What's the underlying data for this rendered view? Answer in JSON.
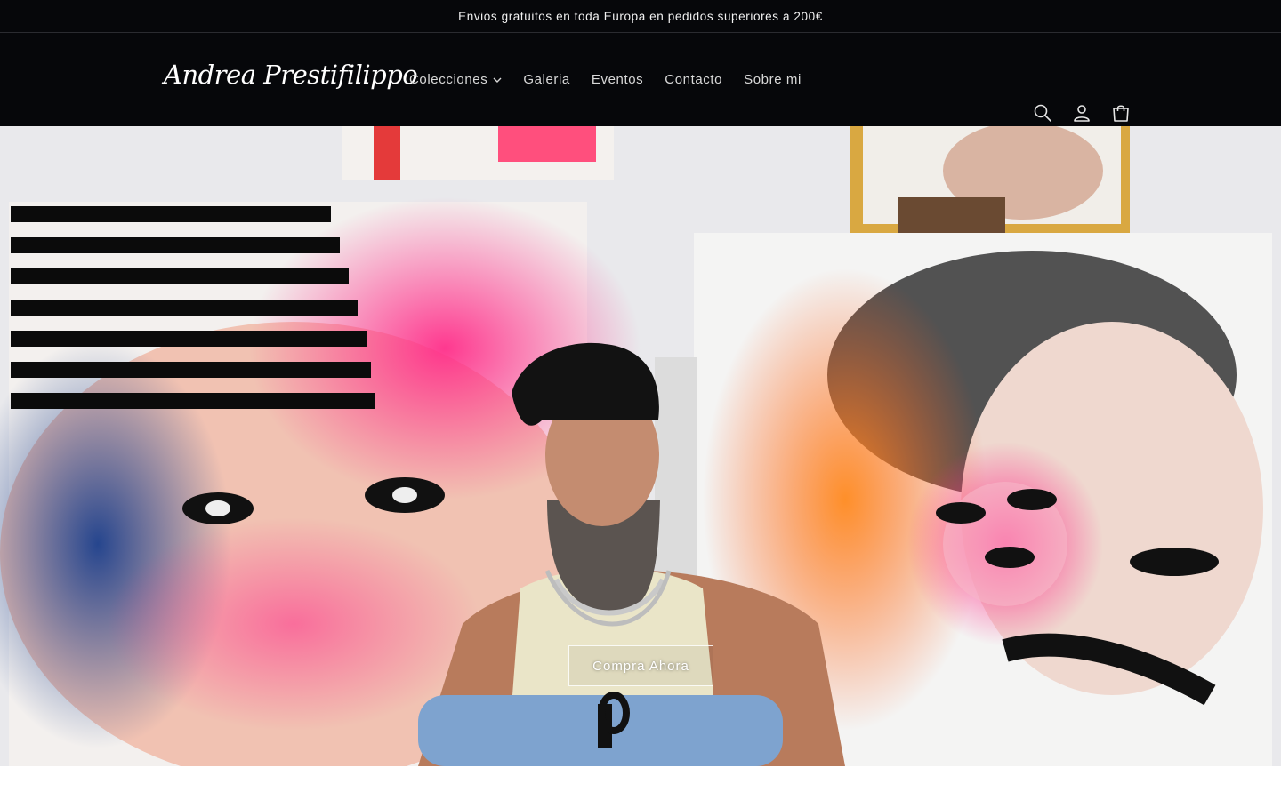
{
  "announcement": {
    "text": "Envios gratuitos en toda Europa en pedidos superiores a 200€"
  },
  "header": {
    "logo_text": "Andrea Prestifilippo",
    "nav": [
      {
        "label": "Colecciones",
        "has_dropdown": true
      },
      {
        "label": "Galeria"
      },
      {
        "label": "Eventos"
      },
      {
        "label": "Contacto"
      },
      {
        "label": "Sobre mi"
      }
    ],
    "icons": [
      "search-icon",
      "account-icon",
      "cart-icon"
    ]
  },
  "hero": {
    "cta_label": "Compra Ahora"
  },
  "colors": {
    "header_bg": "#06070a",
    "nav_text": "#d9d9d9",
    "accent_pink": "#ff2f8a",
    "accent_orange": "#ff7a1f"
  }
}
